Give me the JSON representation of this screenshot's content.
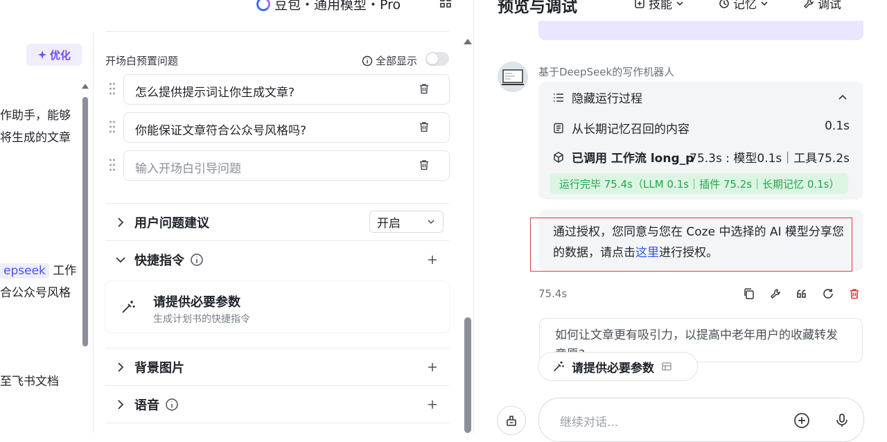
{
  "header": {
    "app_title": "豆包・通用模型・Pro",
    "preview_title": "预览与调试",
    "toolbar": [
      {
        "label": "技能",
        "icon": "skill-icon"
      },
      {
        "label": "记忆",
        "icon": "memory-icon"
      },
      {
        "label": "调试",
        "icon": "wrench-icon"
      }
    ]
  },
  "left": {
    "optimize_label": "优化",
    "lines": [
      "作助手，能够",
      "将生成的文章",
      "epseek",
      "工作",
      "合公众号风格",
      "至飞书文档"
    ]
  },
  "opening": {
    "section_label": "开场白预置问题",
    "show_all_label": "全部显示",
    "questions": [
      {
        "text": "怎么提供提示词让你生成文章?"
      },
      {
        "text": "你能保证文章符合公众号风格吗?"
      }
    ],
    "new_placeholder": "输入开场白引导问题"
  },
  "sections": {
    "suggestions": {
      "label": "用户问题建议",
      "value": "开启"
    },
    "shortcuts": {
      "label": "快捷指令"
    },
    "shortcut_card": {
      "title": "请提供必要参数",
      "desc": "生成计划书的快捷指令"
    },
    "background": {
      "label": "背景图片"
    },
    "voice": {
      "label": "语音"
    }
  },
  "chat": {
    "bot_name": "基于DeepSeek的写作机器人",
    "process": {
      "hide_label": "隐藏运行过程",
      "memory_label": "从长期记忆召回的内容",
      "memory_time": "0.1s",
      "workflow_label": "已调用 工作流 long_pc",
      "workflow_stats": "75.3s : 模型0.1s｜工具75.2s",
      "done_text": "运行完毕 75.4s（LLM 0.1s｜插件 75.2s｜长期记忆 0.1s）"
    },
    "auth_before": "通过授权，您同意与您在 Coze 中选择的 AI 模型分享您的数据，请点击",
    "auth_link": "这里",
    "auth_after": "进行授权。",
    "msg_time": "75.4s",
    "suggestion_text": "如何让文章更有吸引力，以提高中老年用户的收藏转发意愿?",
    "shortcut_pill": "请提供必要参数",
    "input_placeholder": "继续对话..."
  },
  "colors": {
    "accent": "#6f4cf7",
    "link": "#2b59e0",
    "success": "#22a64a",
    "danger": "#e0383e"
  }
}
